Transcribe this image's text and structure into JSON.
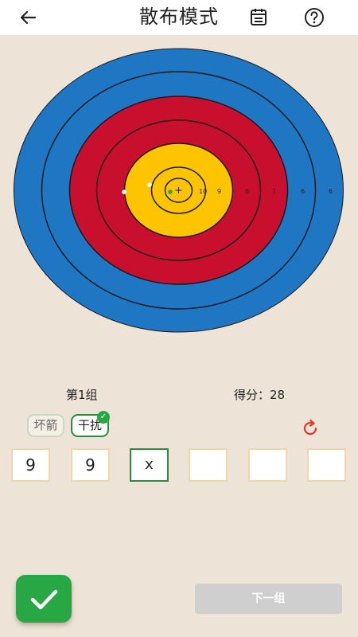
{
  "header": {
    "title": "散布模式",
    "back_icon": "arrow-left-icon",
    "list_icon": "list-icon",
    "help_icon": "help-circle-icon"
  },
  "target": {
    "ring_labels": [
      "10",
      "9",
      "8",
      "7",
      "6",
      "6"
    ],
    "colors": {
      "blue": "#1f77c4",
      "red": "#c8102e",
      "yellow": "#ffc400",
      "line": "#1a1a1a"
    }
  },
  "group": {
    "label": "第1组",
    "score_text": "得分：28"
  },
  "chips": {
    "bad_arrow": "坏箭",
    "interference": "干扰"
  },
  "scores": [
    "9",
    "9",
    "x",
    "",
    "",
    ""
  ],
  "active_score_index": 2,
  "actions": {
    "next_label": "下一组",
    "confirm_icon": "check-icon",
    "reset_icon": "refresh-icon"
  },
  "theme": {
    "accent": "#28a745",
    "background": "#ede3d6",
    "reset": "#e03a2f"
  }
}
